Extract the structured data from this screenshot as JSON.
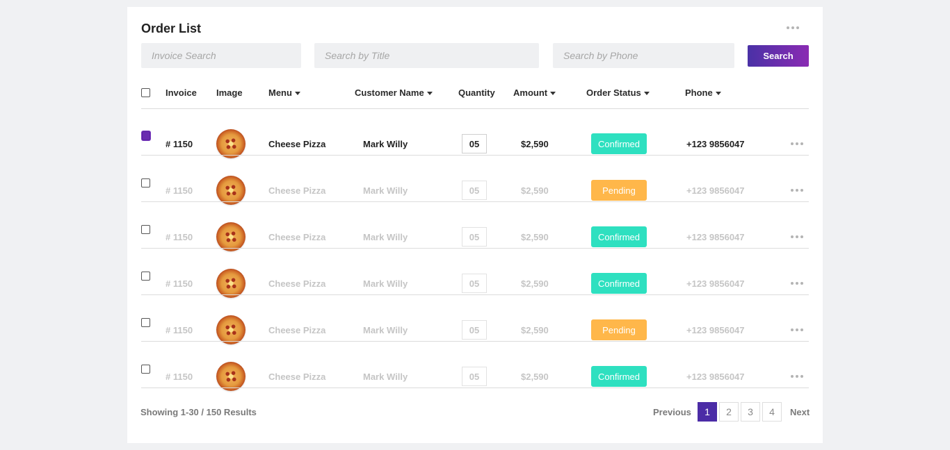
{
  "card": {
    "title": "Order List"
  },
  "search": {
    "invoice_placeholder": "Invoice Search",
    "title_placeholder": "Search by Title",
    "phone_placeholder": "Search by Phone",
    "button_label": "Search"
  },
  "table": {
    "headers": {
      "invoice": "Invoice",
      "image": "Image",
      "menu": "Menu",
      "customer": "Customer Name",
      "quantity": "Quantity",
      "amount": "Amount",
      "status": "Order Status",
      "phone": "Phone"
    },
    "rows": [
      {
        "invoice": "# 1150",
        "image": "pizza",
        "menu": "Cheese Pizza",
        "customer": "Mark Willy",
        "quantity": "05",
        "amount": "$2,590",
        "status": "Confirmed",
        "phone": "+123 9856047",
        "checked": true
      },
      {
        "invoice": "# 1150",
        "image": "pizza",
        "menu": "Cheese Pizza",
        "customer": "Mark Willy",
        "quantity": "05",
        "amount": "$2,590",
        "status": "Pending",
        "phone": "+123 9856047",
        "checked": false
      },
      {
        "invoice": "# 1150",
        "image": "pizza",
        "menu": "Cheese Pizza",
        "customer": "Mark Willy",
        "quantity": "05",
        "amount": "$2,590",
        "status": "Confirmed",
        "phone": "+123 9856047",
        "checked": false
      },
      {
        "invoice": "# 1150",
        "image": "pizza",
        "menu": "Cheese Pizza",
        "customer": "Mark Willy",
        "quantity": "05",
        "amount": "$2,590",
        "status": "Confirmed",
        "phone": "+123 9856047",
        "checked": false
      },
      {
        "invoice": "# 1150",
        "image": "pizza",
        "menu": "Cheese Pizza",
        "customer": "Mark Willy",
        "quantity": "05",
        "amount": "$2,590",
        "status": "Pending",
        "phone": "+123 9856047",
        "checked": false
      },
      {
        "invoice": "# 1150",
        "image": "pizza",
        "menu": "Cheese Pizza",
        "customer": "Mark Willy",
        "quantity": "05",
        "amount": "$2,590",
        "status": "Confirmed",
        "phone": "+123 9856047",
        "checked": false
      }
    ]
  },
  "footer": {
    "showing": "Showing 1-30 / 150 Results",
    "previous": "Previous",
    "next": "Next",
    "pages": [
      "1",
      "2",
      "3",
      "4"
    ],
    "current_page": "1"
  },
  "colors": {
    "accent": "#4b2ca6",
    "confirmed": "#2ee0c0",
    "pending": "#ffb74a"
  },
  "icons": {
    "more": "more-horizontal-icon",
    "sort": "caret-down-icon"
  }
}
